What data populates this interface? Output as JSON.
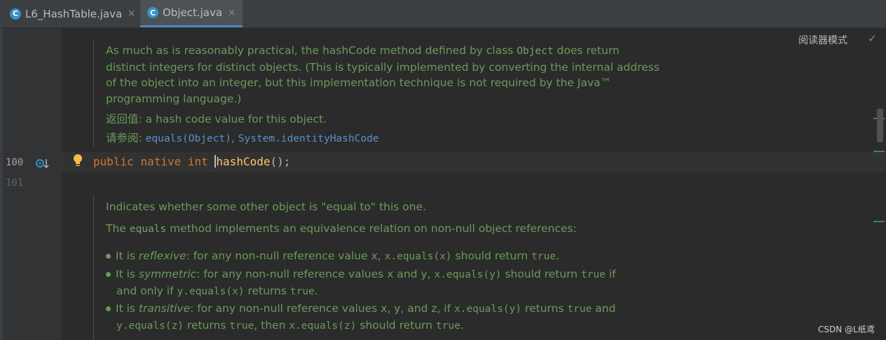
{
  "tabs": [
    {
      "icon": "C",
      "label": "L6_HashTable.java",
      "close": "×"
    },
    {
      "icon": "C",
      "label": "Object.java",
      "close": "×"
    }
  ],
  "reader_mode": "阅读器模式",
  "gutter": {
    "line_100": "100",
    "line_101": "101"
  },
  "doc1": {
    "l1a": "As much as is reasonably practical, the hashCode method defined by class ",
    "l1code": "Object",
    "l1b": " does return",
    "l2": "distinct integers for distinct objects. (This is typically implemented by converting the internal address",
    "l3": "of the object into an integer, but this implementation technique is not required by the Java™",
    "l4": "programming language.)",
    "returns_label": "返回值:",
    "returns_text": " a hash code value for this object.",
    "see_label": "请参阅:",
    "see_link1": "equals(Object)",
    "see_sep": ", ",
    "see_link2": "System.identityHashCode"
  },
  "code": {
    "kw1": "public",
    "kw2": "native",
    "kw3": "int",
    "method": "hashCode",
    "tail": "();"
  },
  "doc2": {
    "p1": "Indicates whether some other object is \"equal to\" this one.",
    "p2a": "The ",
    "p2code": "equals",
    "p2b": " method implements an equivalence relation on non-null object references:",
    "b1a": "It is ",
    "b1em": "reflexive",
    "b1b": ": for any non-null reference value x, ",
    "b1c1": "x.equals(x)",
    "b1d": " should return ",
    "b1c2": "true",
    "b1e": ".",
    "b2a": "It is ",
    "b2em": "symmetric",
    "b2b": ": for any non-null reference values x and y, ",
    "b2c1": "x.equals(y)",
    "b2d": " should return ",
    "b2c2": "true",
    "b2e": " if",
    "b2f": "and only if ",
    "b2c3": "y.equals(x)",
    "b2g": " returns ",
    "b2c4": "true",
    "b2h": ".",
    "b3a": "It is ",
    "b3em": "transitive",
    "b3b": ": for any non-null reference values x, y, and z, if ",
    "b3c1": "x.equals(y)",
    "b3d": " returns ",
    "b3c2": "true",
    "b3e": " and",
    "b3c3": "y.equals(z)",
    "b3f": " returns ",
    "b3c4": "true",
    "b3g": ", then ",
    "b3c5": "x.equals(z)",
    "b3h": " should return ",
    "b3c6": "true",
    "b3i": "."
  },
  "watermark": "CSDN @L纸鸢"
}
